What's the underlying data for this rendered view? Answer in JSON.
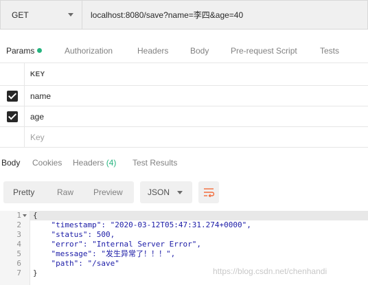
{
  "request": {
    "method": "GET",
    "url": "localhost:8080/save?name=李四&age=40"
  },
  "request_tabs": [
    {
      "label": "Params",
      "active": true
    },
    {
      "label": "Authorization"
    },
    {
      "label": "Headers"
    },
    {
      "label": "Body"
    },
    {
      "label": "Pre-request Script"
    },
    {
      "label": "Tests"
    }
  ],
  "params": {
    "header_key": "KEY",
    "rows": [
      {
        "key": "name",
        "checked": true
      },
      {
        "key": "age",
        "checked": true
      }
    ],
    "new_key_placeholder": "Key"
  },
  "response_tabs": [
    {
      "label": "Body",
      "active": true
    },
    {
      "label": "Cookies"
    },
    {
      "label": "Headers",
      "count": "(4)"
    },
    {
      "label": "Test Results"
    }
  ],
  "response_toolbar": {
    "views": [
      "Pretty",
      "Raw",
      "Preview"
    ],
    "active_view": "Pretty",
    "format": "JSON",
    "wrap_icon": "wrap-lines-icon"
  },
  "response_body": {
    "line_numbers": [
      "1",
      "2",
      "3",
      "4",
      "5",
      "6",
      "7"
    ],
    "lines": [
      "{",
      "    \"timestamp\": \"2020-03-12T05:47:31.274+0000\",",
      "    \"status\": 500,",
      "    \"error\": \"Internal Server Error\",",
      "    \"message\": \"发生异常了！！！\",",
      "    \"path\": \"/save\"",
      "}"
    ]
  },
  "watermark": "https://blog.csdn.net/chenhandi",
  "colors": {
    "accent_green": "#26b47f",
    "wrap_icon_orange": "#f26b3a",
    "json_value_blue": "#1a1aa6"
  }
}
